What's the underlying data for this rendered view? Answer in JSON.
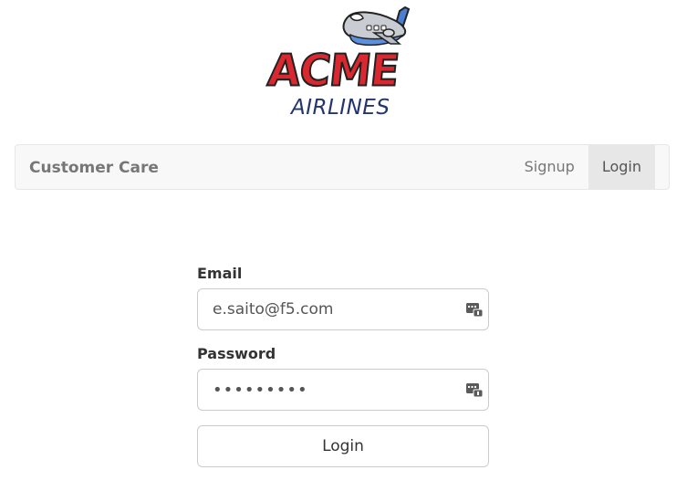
{
  "logo": {
    "word": "ACME",
    "subtitle": "AIRLINES",
    "icon": "cartoon-airplane-icon"
  },
  "navbar": {
    "brand": "Customer Care",
    "links": [
      {
        "label": "Signup",
        "active": false
      },
      {
        "label": "Login",
        "active": true
      }
    ]
  },
  "form": {
    "email_label": "Email",
    "email_value": "e.saito@f5.com",
    "password_label": "Password",
    "password_value": "•••••••••",
    "submit_label": "Login",
    "autofill_icon": "password-manager-key-icon"
  },
  "colors": {
    "brand_red": "#d9282f",
    "brand_navy": "#23356d",
    "navbar_bg": "#f8f8f8",
    "active_tab_bg": "#e7e7e7"
  }
}
